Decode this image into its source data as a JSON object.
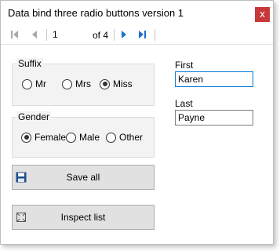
{
  "window": {
    "title": "Data bind three radio buttons version 1",
    "close_glyph": "x"
  },
  "navigator": {
    "position": "1",
    "count_label": "of 4"
  },
  "suffix": {
    "label": "Suffix",
    "options": [
      "Mr",
      "Mrs",
      "Miss"
    ],
    "selected": "Miss"
  },
  "gender": {
    "label": "Gender",
    "options": [
      "Female",
      "Male",
      "Other"
    ],
    "selected": "Female"
  },
  "buttons": {
    "save_label": "Save all",
    "inspect_label": "Inspect list"
  },
  "fields": {
    "first_label": "First",
    "first_value": "Karen",
    "last_label": "Last",
    "last_value": "Payne"
  },
  "colors": {
    "close_button": "#c8383a",
    "nav_active": "#1f6fd1",
    "nav_disabled": "#a8a8a8",
    "focus_border": "#0078d7",
    "save_icon": "#1e4f8f"
  }
}
